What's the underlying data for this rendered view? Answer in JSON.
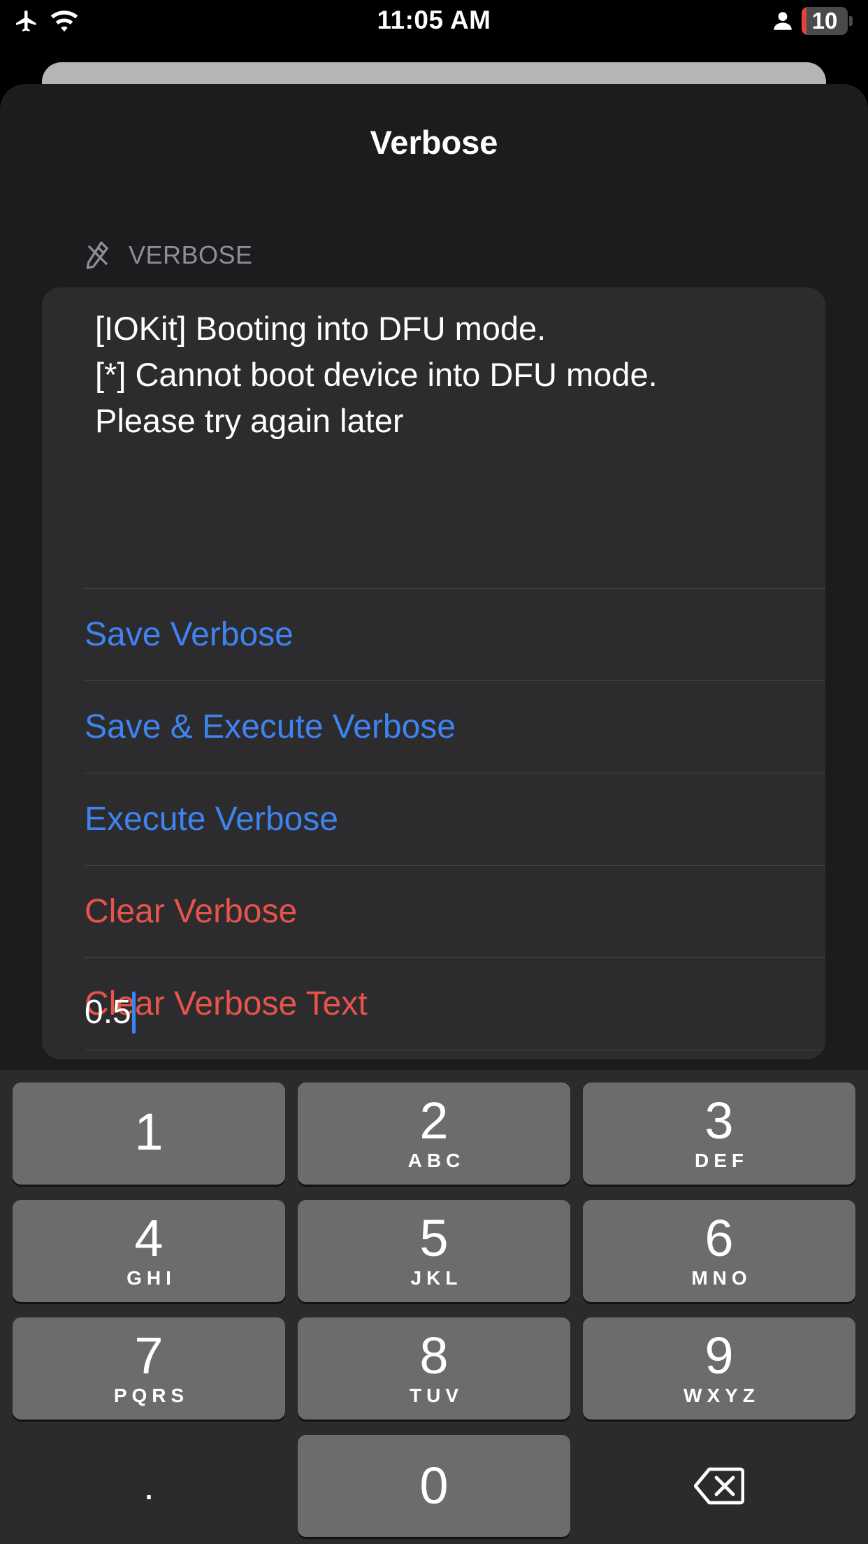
{
  "status_bar": {
    "time": "11:05 AM",
    "battery_level": "10",
    "battery_fraction": 0.1,
    "icons": [
      "airplane-icon",
      "wifi-icon",
      "person-icon",
      "battery-icon"
    ]
  },
  "sheet": {
    "title": "Verbose",
    "section_header": "VERBOSE",
    "section_icon": "pencil-slash-icon",
    "verbose_text": "[IOKit] Booting into DFU mode.\n[*] Cannot boot device into DFU mode.\nPlease try again later",
    "actions": [
      {
        "label": "Save Verbose",
        "style": "blue"
      },
      {
        "label": "Save & Execute Verbose",
        "style": "blue"
      },
      {
        "label": "Execute Verbose",
        "style": "blue"
      },
      {
        "label": "Clear Verbose",
        "style": "red"
      },
      {
        "label": "Clear Verbose Text",
        "style": "red"
      }
    ],
    "input_value": "0.5"
  },
  "keyboard": {
    "keys": [
      {
        "num": "1",
        "letters": ""
      },
      {
        "num": "2",
        "letters": "ABC"
      },
      {
        "num": "3",
        "letters": "DEF"
      },
      {
        "num": "4",
        "letters": "GHI"
      },
      {
        "num": "5",
        "letters": "JKL"
      },
      {
        "num": "6",
        "letters": "MNO"
      },
      {
        "num": "7",
        "letters": "PQRS"
      },
      {
        "num": "8",
        "letters": "TUV"
      },
      {
        "num": "9",
        "letters": "WXYZ"
      },
      {
        "num": ".",
        "letters": ""
      },
      {
        "num": "0",
        "letters": ""
      }
    ],
    "delete_icon": "backspace-icon"
  },
  "colors": {
    "accent_blue": "#3f83f0",
    "destructive_red": "#e8534a",
    "sheet_bg": "#1c1c1e",
    "card_bg": "#2c2c2e",
    "key_bg": "#6c6c6c"
  }
}
